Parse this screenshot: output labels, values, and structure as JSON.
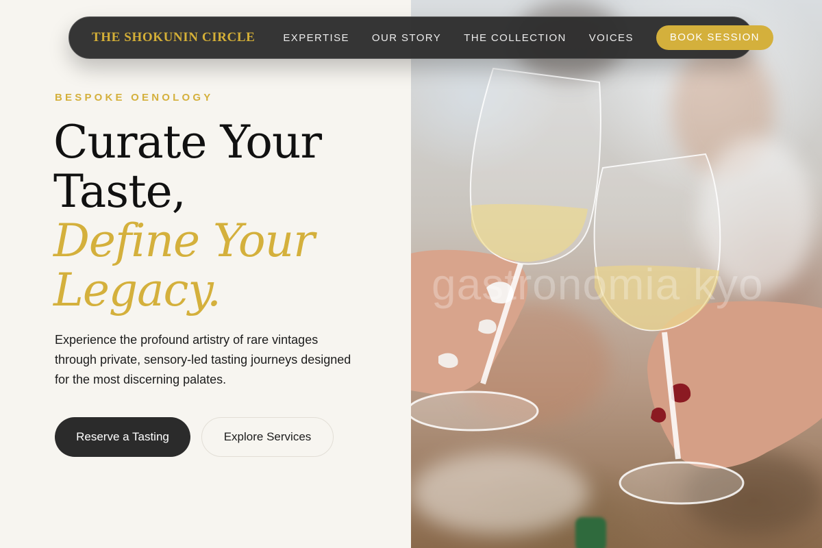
{
  "nav": {
    "brand": "THE SHOKUNIN CIRCLE",
    "links": [
      "EXPERTISE",
      "OUR STORY",
      "THE COLLECTION",
      "VOICES"
    ],
    "cta": "BOOK SESSION"
  },
  "hero": {
    "eyebrow": "BESPOKE OENOLOGY",
    "headline_line1": "Curate Your",
    "headline_line2": "Taste,",
    "headline_accent_line1": "Define Your",
    "headline_accent_line2": "Legacy.",
    "description": "Experience the profound artistry of rare vintages through private, sensory-led tasting journeys designed for the most discerning palates.",
    "primary_button": "Reserve a Tasting",
    "secondary_button": "Explore Services"
  },
  "image": {
    "subject": "wine-toast-photo",
    "watermark": "gastronomia kyo"
  },
  "colors": {
    "accent": "#d4b03c",
    "dark": "#2b2b2b",
    "background": "#f7f5f0"
  }
}
